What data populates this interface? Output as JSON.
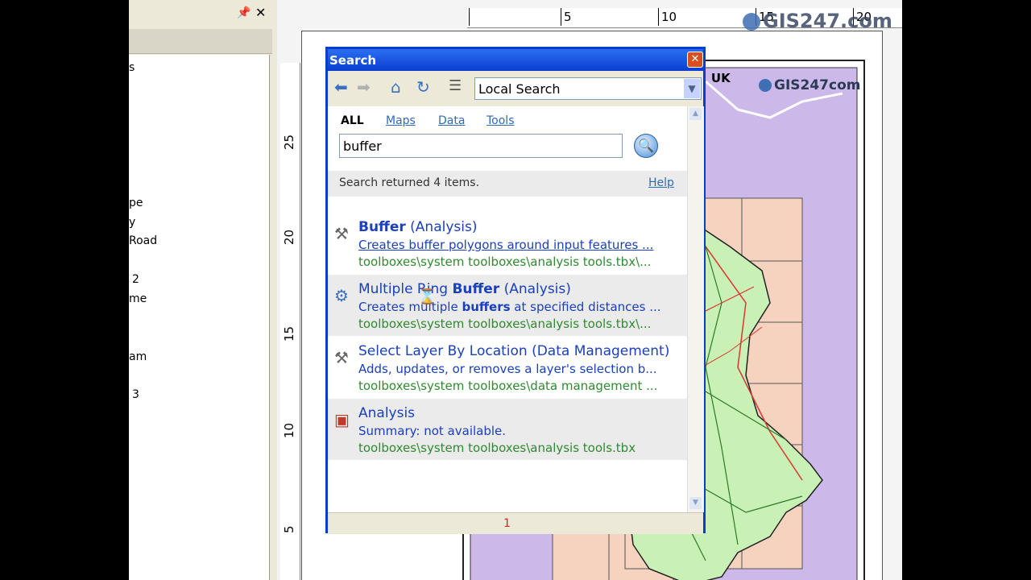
{
  "toc": {
    "fragments": [
      "s",
      "pe",
      "y",
      "Road",
      "2",
      "me",
      "am",
      "3"
    ]
  },
  "layout": {
    "ruler_top_labels": [
      "5",
      "10",
      "15",
      "20"
    ],
    "ruler_left_labels": [
      "25",
      "20",
      "15",
      "10",
      "5"
    ],
    "map_title_fragment": ", UK",
    "logo_text": "GIS247.com",
    "logo_small_text": "GIS247com"
  },
  "search_window": {
    "title": "Search",
    "scope": "Local Search",
    "filters": {
      "all": "ALL",
      "maps": "Maps",
      "data": "Data",
      "tools": "Tools"
    },
    "query": "buffer",
    "status": "Search returned 4 items.",
    "help": "Help",
    "results": [
      {
        "title_bold": "Buffer",
        "title_rest": " (Analysis)",
        "summary": "Creates buffer polygons around input features ...",
        "path": "toolboxes\\system toolboxes\\analysis tools.tbx\\...",
        "icon": "hammer-icon"
      },
      {
        "title_pre": "Multiple Ring ",
        "title_bold": "Buffer",
        "title_rest": " (Analysis)",
        "summary_pre": "Creates multiple ",
        "summary_bold": "buffers",
        "summary_post": " at specified distances ...",
        "path": "toolboxes\\system toolboxes\\analysis tools.tbx\\...",
        "icon": "script-tool-icon"
      },
      {
        "title": "Select Layer By Location (Data Management)",
        "summary": "Adds, updates, or removes a layer's selection b...",
        "path": "toolboxes\\system toolboxes\\data management ...",
        "icon": "hammer-icon"
      },
      {
        "title": "Analysis",
        "summary": "Summary: not available.",
        "path": "toolboxes\\system toolboxes\\analysis tools.tbx",
        "icon": "toolbox-icon"
      }
    ],
    "page": "1"
  },
  "colors": {
    "title_bar": "#0a3ed0",
    "link": "#2f6bb5",
    "result_title": "#1a3fbf",
    "result_path": "#2e8b2e",
    "map_land": "#c9f0b5",
    "map_sea": "#cdb8ea",
    "map_grid": "#f5d3bf"
  }
}
